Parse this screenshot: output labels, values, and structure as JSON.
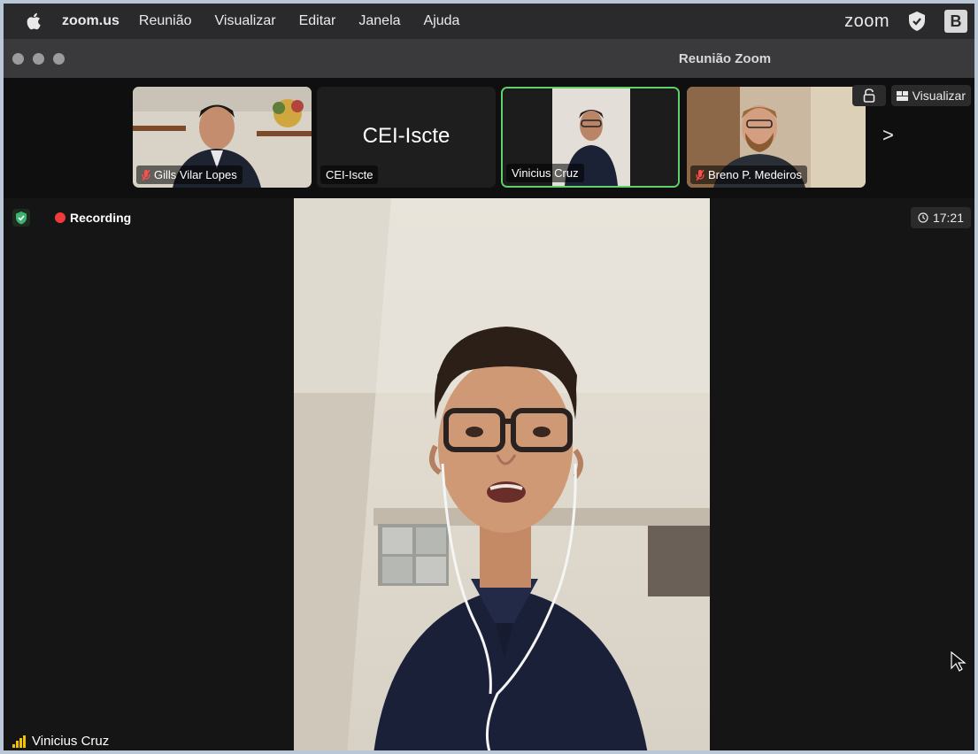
{
  "menubar": {
    "app_name": "zoom.us",
    "items": [
      "Reunião",
      "Visualizar",
      "Editar",
      "Janela",
      "Ajuda"
    ],
    "zoom_word": "zoom",
    "b_icon": "B",
    "icons": [
      "apple-icon",
      "zoom-logo",
      "shield-check-icon",
      "b-app-icon"
    ]
  },
  "window": {
    "title": "Reunião Zoom"
  },
  "strip": {
    "tiles": [
      {
        "name": "Gills Vilar Lopes",
        "muted": true
      },
      {
        "name": "CEI-Iscte",
        "big_text": "CEI-Iscte",
        "muted": false
      },
      {
        "name": "Vinicius Cruz",
        "muted": false,
        "active": true
      },
      {
        "name": "Breno P. Medeiros",
        "muted": true
      }
    ],
    "view_label": "Visualizar",
    "next_symbol": ">"
  },
  "main": {
    "recording_label": "Recording",
    "timer": "17:21",
    "speaker_name": "Vinicius Cruz"
  },
  "colors": {
    "active_border": "#5fd16a",
    "recording_red": "#ee3c3c",
    "shield_green": "#3cb371",
    "signal_yellow": "#f2c200"
  }
}
